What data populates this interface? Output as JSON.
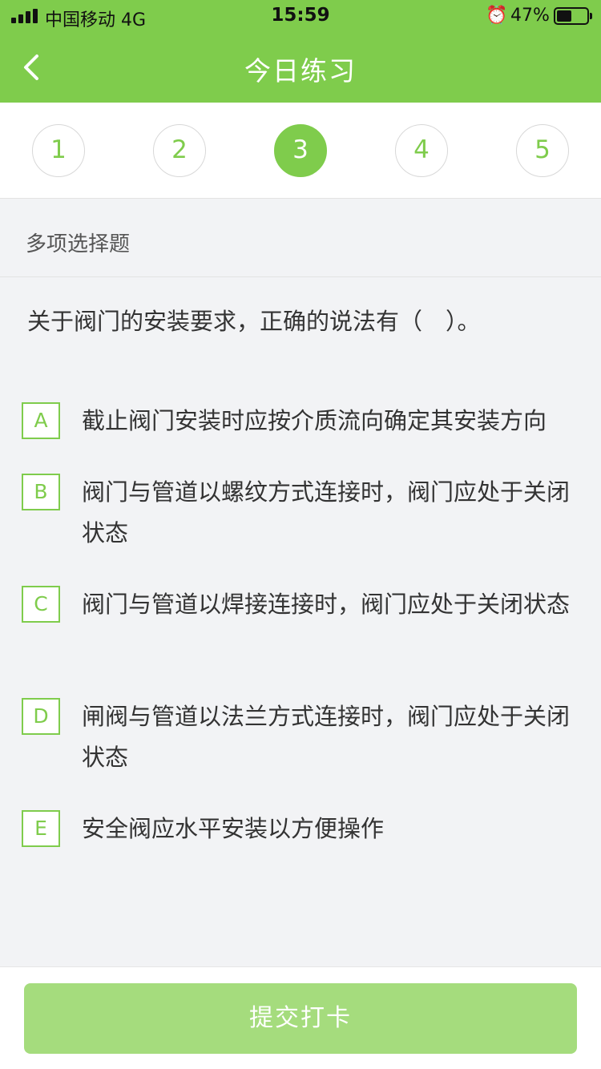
{
  "status_bar": {
    "carrier": "中国移动  4G",
    "time": "15:59",
    "battery_pct": "47%",
    "alarm_icon": "alarm-icon"
  },
  "header": {
    "title": "今日练习",
    "back_icon": "chevron-left-icon"
  },
  "tabs": [
    "1",
    "2",
    "3",
    "4",
    "5"
  ],
  "active_tab": 3,
  "question_type": "多项选择题",
  "question": "关于阀门的安装要求，正确的说法有（　）。",
  "options": [
    {
      "letter": "A",
      "text": "截止阀门安装时应按介质流向确定其安装方向"
    },
    {
      "letter": "B",
      "text": "阀门与管道以螺纹方式连接时，阀门应处于关闭状态"
    },
    {
      "letter": "C",
      "text": "阀门与管道以焊接连接时，阀门应处于关闭状态"
    },
    {
      "letter": "D",
      "text": "闸阀与管道以法兰方式连接时，阀门应处于关闭状态"
    },
    {
      "letter": "E",
      "text": "安全阀应水平安装以方便操作"
    }
  ],
  "submit_label": "提交打卡",
  "colors": {
    "accent": "#7fcc4c",
    "submit_disabled": "#a5dc7d",
    "background": "#f2f3f5"
  }
}
